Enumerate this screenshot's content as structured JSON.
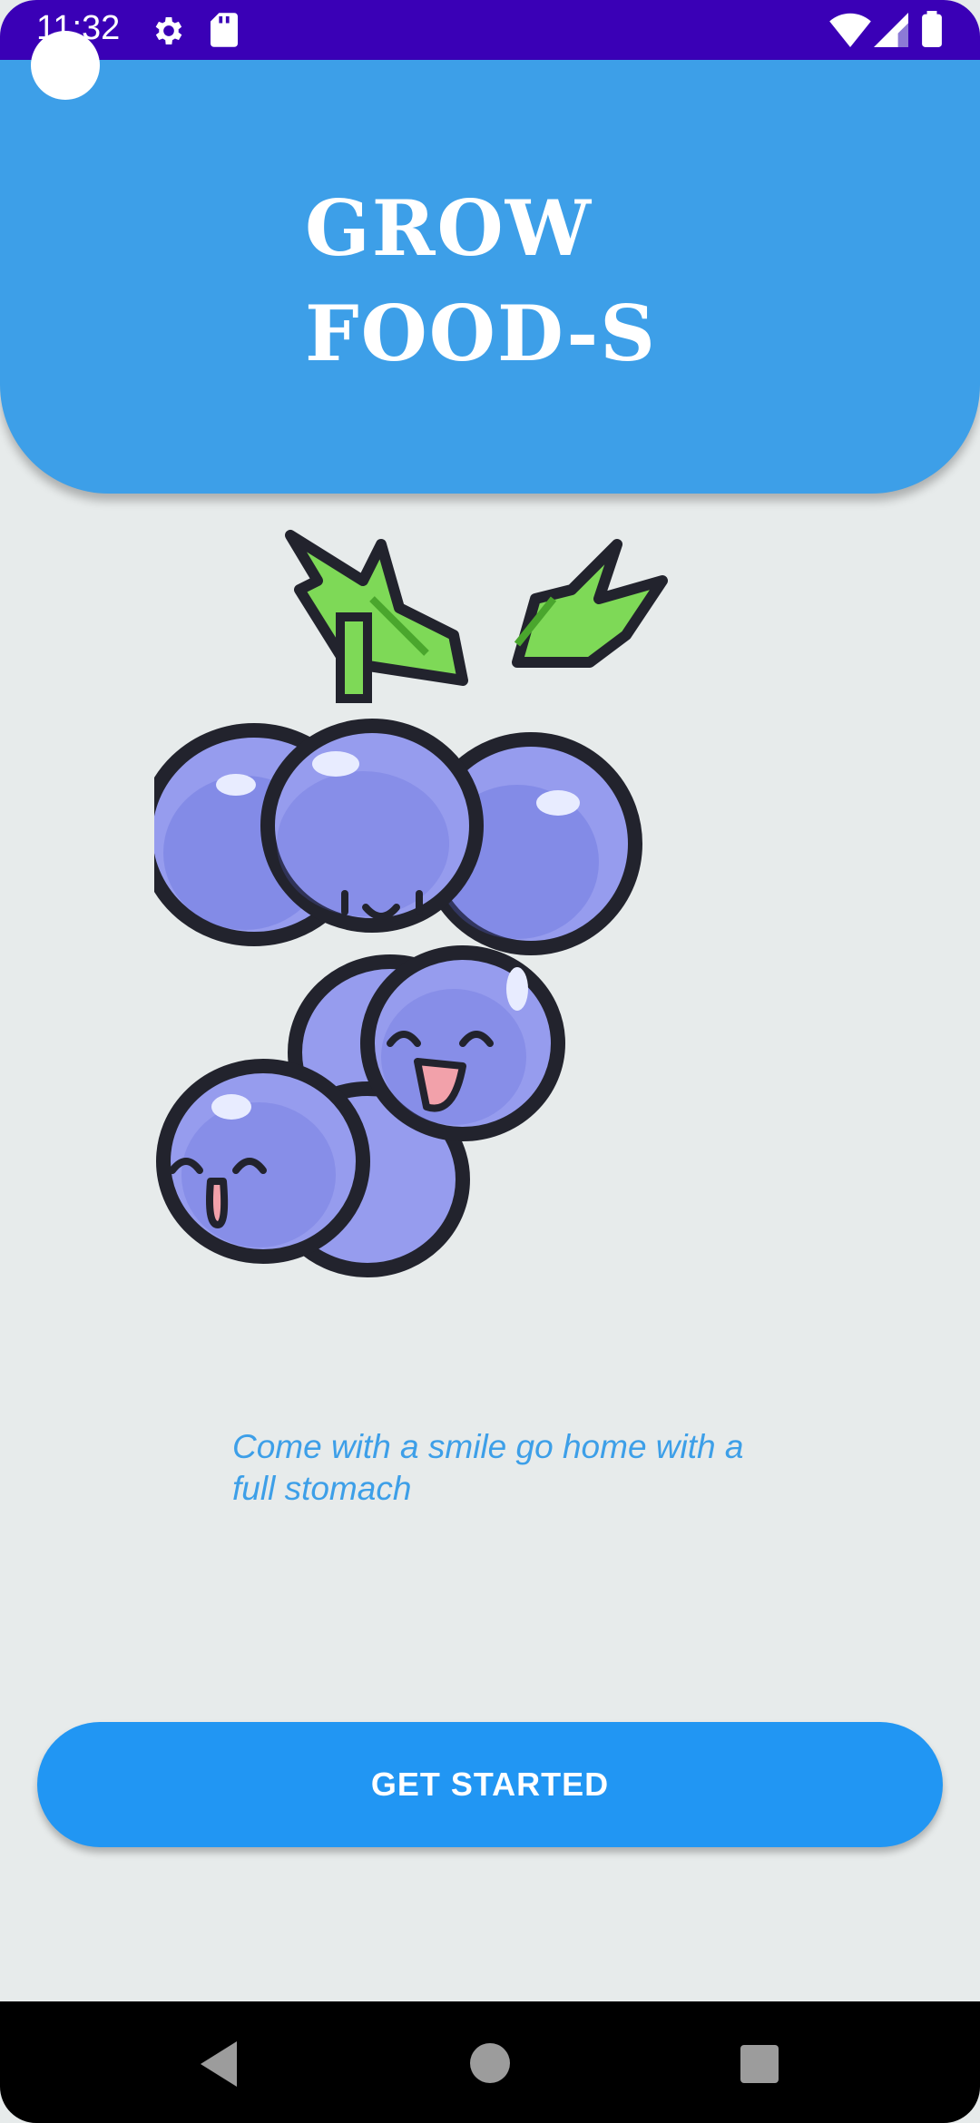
{
  "status_bar": {
    "time": "11:32",
    "icons": [
      "gear-icon",
      "sd-card-icon",
      "wifi-icon",
      "signal-icon",
      "battery-icon"
    ],
    "background": "#3a00b6"
  },
  "header": {
    "title": "GROW\nFOOD-S",
    "background": "#3d9fe8"
  },
  "illustration": {
    "name": "grapes-illustration"
  },
  "tagline": "Come with a smile go home with a full stomach",
  "cta": {
    "label": "GET STARTED",
    "color": "#2196f3"
  },
  "nav_bar": {
    "icons": [
      "back-icon",
      "home-icon",
      "recents-icon"
    ]
  }
}
